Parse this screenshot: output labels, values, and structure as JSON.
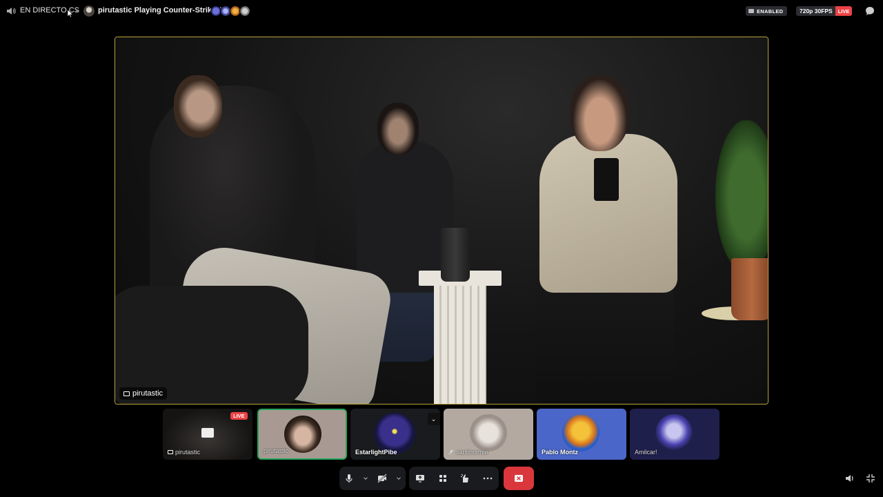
{
  "topbar": {
    "channel": "EN DIRECTO CS",
    "activity": "pirutastic Playing Counter-Strike 2",
    "enabled_badge": "ENABLED",
    "quality": "720p 30FPS",
    "live": "LIVE"
  },
  "stage": {
    "streamer_name": "pirutastic"
  },
  "tiles": [
    {
      "name": "pirutastic",
      "badge": "LIVE"
    },
    {
      "name": "pirutastic"
    },
    {
      "name": "EstarlightPibe"
    },
    {
      "name": "santinormie"
    },
    {
      "name": "Pablo Montz"
    },
    {
      "name": "Amilcar!"
    }
  ],
  "colors": {
    "live_red": "#ed4245",
    "speaking_green": "#23a55a",
    "leave_red": "#da373c",
    "stage_border": "#b9a33a"
  },
  "icons": {
    "topbar": [
      "volume-icon",
      "camera-icon",
      "chat-icon"
    ],
    "controls": [
      "microphone-icon",
      "chevron-down-icon",
      "camera-off-icon",
      "chevron-down-icon",
      "screen-share-icon",
      "activities-icon",
      "soundboard-icon",
      "more-icon",
      "leave-call-icon"
    ],
    "bottom_right": [
      "volume-icon",
      "exit-fullscreen-icon"
    ]
  }
}
